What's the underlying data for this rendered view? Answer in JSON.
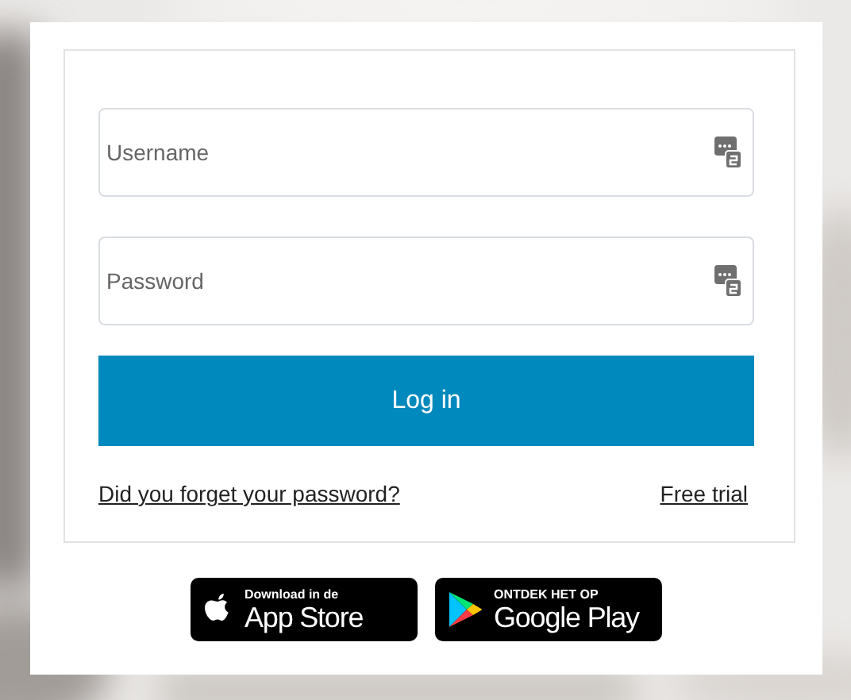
{
  "form": {
    "fields": [
      {
        "placeholder": "Username"
      },
      {
        "placeholder": "Password"
      }
    ],
    "login_button": "Log in",
    "links": [
      "Did you forget your password?",
      "Free trial"
    ]
  },
  "store_badges": [
    {
      "kind": "apple",
      "small": "Download in de",
      "large": "App Store"
    },
    {
      "kind": "google",
      "small": "ONTDEK HET OP",
      "large": "Google Play"
    }
  ]
}
